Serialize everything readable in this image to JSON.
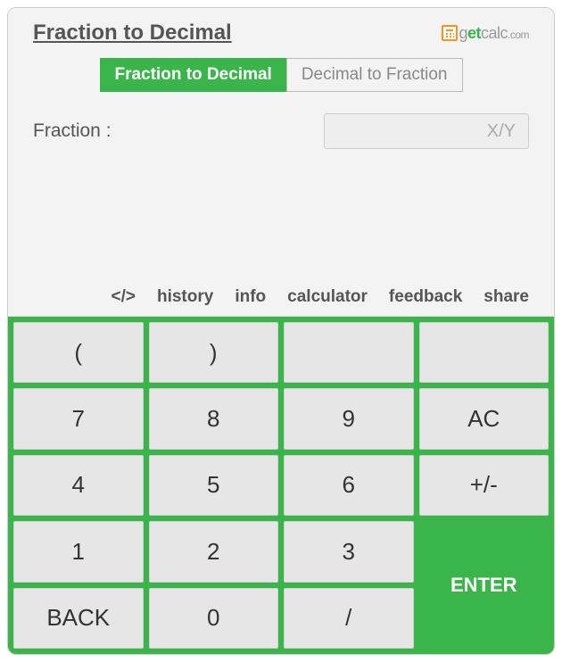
{
  "title": "Fraction to Decimal",
  "logo": {
    "prefix": "g",
    "highlight": "et",
    "suffix": "calc",
    "tld": ".com"
  },
  "tabs": {
    "active": "Fraction to Decimal",
    "inactive": "Decimal to Fraction"
  },
  "input": {
    "label": "Fraction :",
    "placeholder": "X/Y",
    "value": ""
  },
  "actions": {
    "embed": "</>",
    "history": "history",
    "info": "info",
    "calculator": "calculator",
    "feedback": "feedback",
    "share": "share"
  },
  "keys": {
    "lp": "(",
    "rp": ")",
    "blank1": "",
    "blank2": "",
    "k7": "7",
    "k8": "8",
    "k9": "9",
    "ac": "AC",
    "k4": "4",
    "k5": "5",
    "k6": "6",
    "pm": "+/-",
    "k1": "1",
    "k2": "2",
    "k3": "3",
    "enter": "ENTER",
    "back": "BACK",
    "k0": "0",
    "slash": "/"
  }
}
